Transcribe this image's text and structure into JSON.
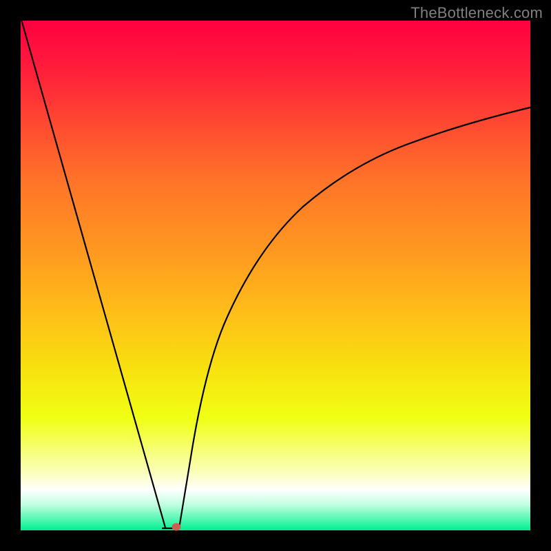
{
  "watermark": "TheBottleneck.com",
  "chart_data": {
    "type": "line",
    "title": "",
    "xlabel": "",
    "ylabel": "",
    "xlim": [
      0,
      100
    ],
    "ylim": [
      0,
      100
    ],
    "gradient_stops": [
      {
        "pct": 0,
        "color": "#ff0040"
      },
      {
        "pct": 10,
        "color": "#ff1f3a"
      },
      {
        "pct": 22,
        "color": "#ff5030"
      },
      {
        "pct": 32,
        "color": "#ff7528"
      },
      {
        "pct": 45,
        "color": "#ff9820"
      },
      {
        "pct": 58,
        "color": "#ffc018"
      },
      {
        "pct": 68,
        "color": "#f8e00f"
      },
      {
        "pct": 78,
        "color": "#f0ff14"
      },
      {
        "pct": 89,
        "color": "#fbffc0"
      },
      {
        "pct": 92,
        "color": "#ffffff"
      },
      {
        "pct": 95,
        "color": "#c0ffe0"
      },
      {
        "pct": 100,
        "color": "#00f090"
      }
    ],
    "series": [
      {
        "name": "left-branch",
        "x": [
          0,
          5,
          10,
          15,
          20,
          25,
          28.5
        ],
        "y": [
          100,
          82,
          65,
          48,
          31,
          14,
          0
        ]
      },
      {
        "name": "right-branch",
        "x": [
          31,
          33,
          36,
          40,
          45,
          50,
          56,
          63,
          71,
          80,
          89,
          100
        ],
        "y": [
          0,
          12,
          24,
          36,
          47,
          55,
          62,
          68,
          73,
          77,
          80,
          83
        ]
      }
    ],
    "marker": {
      "name": "optimal-point",
      "x": 30.5,
      "y": 0,
      "color": "#cc6050"
    }
  }
}
